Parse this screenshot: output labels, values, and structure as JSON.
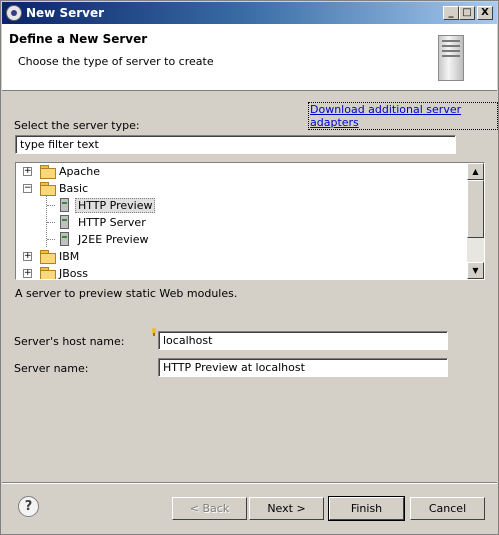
{
  "window": {
    "title": "New Server"
  },
  "header": {
    "title": "Define a New Server",
    "description": "Choose the type of server to create"
  },
  "download_link": "Download additional server adapters",
  "server_type": {
    "label": "Select the server type:",
    "filter_value": "type filter text"
  },
  "tree": {
    "items": [
      {
        "label": "Apache",
        "type": "folder",
        "expanded": false
      },
      {
        "label": "Basic",
        "type": "folder",
        "expanded": true
      },
      {
        "label": "HTTP Preview",
        "type": "server",
        "selected": true
      },
      {
        "label": "HTTP Server",
        "type": "server"
      },
      {
        "label": "J2EE Preview",
        "type": "server"
      },
      {
        "label": "IBM",
        "type": "folder",
        "expanded": false
      },
      {
        "label": "JBoss",
        "type": "folder",
        "expanded": false
      }
    ]
  },
  "selected_description": "A server to preview static Web modules.",
  "host": {
    "label": "Server's host name:",
    "value": "localhost"
  },
  "server_name": {
    "label": "Server name:",
    "value": "HTTP Preview at localhost"
  },
  "buttons": {
    "back": "< Back",
    "next": "Next >",
    "finish": "Finish",
    "cancel": "Cancel"
  },
  "titlebar_buttons": {
    "minimize": "_",
    "maximize": "□",
    "close": "X"
  }
}
